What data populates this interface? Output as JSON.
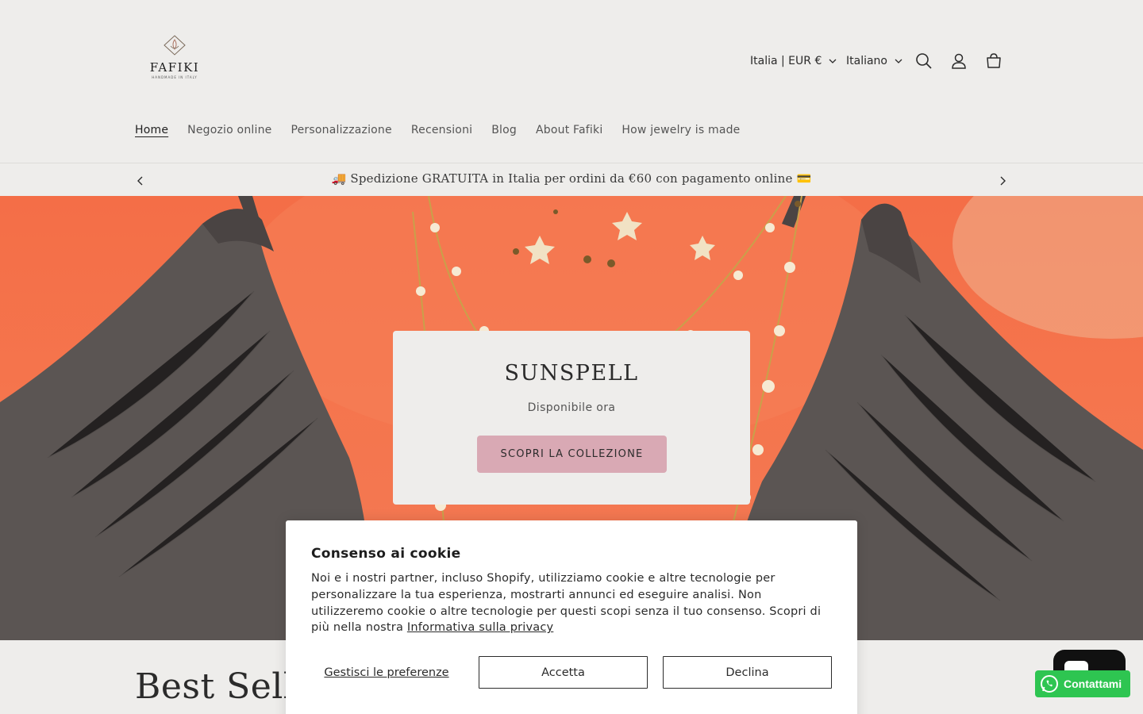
{
  "brand": {
    "name": "FAFIKI",
    "tagline": "HANDMADE IN ITALY"
  },
  "header": {
    "country_currency": "Italia | EUR €",
    "language": "Italiano",
    "icons": [
      "search-icon",
      "account-icon",
      "cart-icon"
    ]
  },
  "nav": {
    "items": [
      {
        "label": "Home",
        "active": true
      },
      {
        "label": "Negozio online"
      },
      {
        "label": "Personalizzazione"
      },
      {
        "label": "Recensioni"
      },
      {
        "label": "Blog"
      },
      {
        "label": "About Fafiki"
      },
      {
        "label": "How jewelry is made"
      }
    ]
  },
  "announcement": {
    "text": "🚚 Spedizione GRATUITA in Italia per ordini da €60 con pagamento online 💳"
  },
  "hero": {
    "title": "SUNSPELL",
    "subtitle": "Disponibile ora",
    "cta": "SCOPRI LA COLLEZIONE"
  },
  "section": {
    "title": "Best Sellers"
  },
  "cookie": {
    "title": "Consenso ai cookie",
    "body": "Noi e i nostri partner, incluso Shopify, utilizziamo cookie e altre tecnologie per personalizzare la tua esperienza, mostrarti annunci ed eseguire analisi. Non utilizzeremo cookie o altre tecnologie per questi scopi senza il tuo consenso. Scopri di più nella nostra ",
    "privacy_link": "Informativa sulla privacy",
    "manage": "Gestisci le preferenze",
    "accept": "Accetta",
    "decline": "Declina"
  },
  "chat": {
    "whatsapp_label": "Contattami"
  },
  "colors": {
    "page_bg": "#eeedeb",
    "cta_pink": "#d9a9b4",
    "whatsapp_green": "#2ec551",
    "hero_orange": "#f46e47"
  }
}
